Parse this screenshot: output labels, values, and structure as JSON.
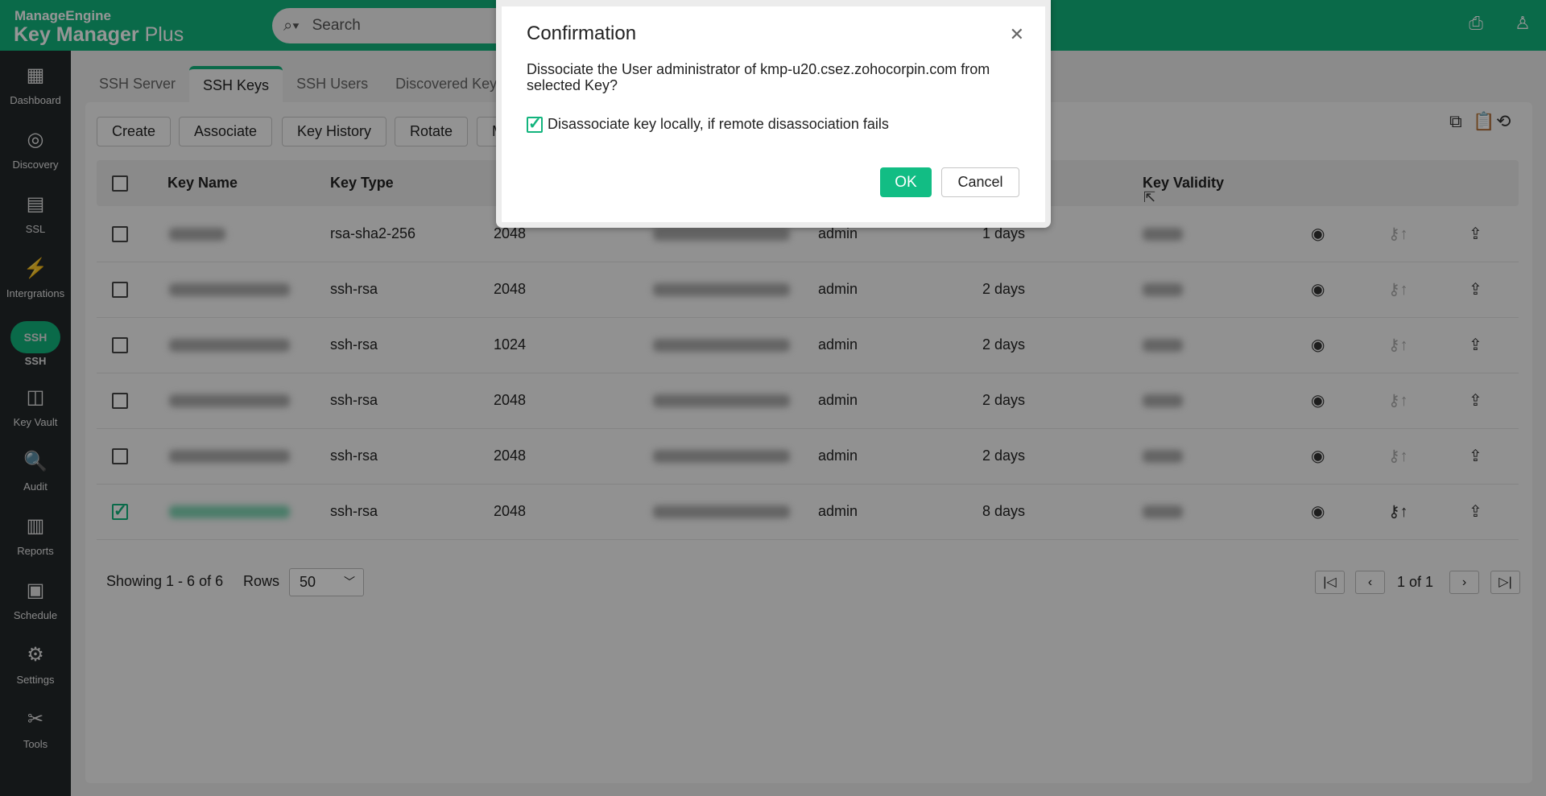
{
  "header": {
    "brand_top": "ManageEngine",
    "product_bold": "Key Manager",
    "product_light": " Plus",
    "search_placeholder": "Search",
    "icons": [
      "notification-icon",
      "user-icon"
    ]
  },
  "sidebar": {
    "items": [
      {
        "label": "Dashboard",
        "icon": "dashboard-icon",
        "glyph": "▦"
      },
      {
        "label": "Discovery",
        "icon": "compass-icon",
        "glyph": "◎"
      },
      {
        "label": "SSL",
        "icon": "ssl-certificate-icon",
        "glyph": "▤"
      },
      {
        "label": "Intergrations",
        "icon": "plug-icon",
        "glyph": "⚡"
      },
      {
        "label": "SSH",
        "icon": "ssh-terminal-icon",
        "glyph": "SSH",
        "active": true
      },
      {
        "label": "Key Vault",
        "icon": "vault-icon",
        "glyph": "◫"
      },
      {
        "label": "Audit",
        "icon": "audit-icon",
        "glyph": "🔍"
      },
      {
        "label": "Reports",
        "icon": "reports-icon",
        "glyph": "▥"
      },
      {
        "label": "Schedule",
        "icon": "calendar-icon",
        "glyph": "▣"
      },
      {
        "label": "Settings",
        "icon": "gear-icon",
        "glyph": "⚙"
      },
      {
        "label": "Tools",
        "icon": "tools-icon",
        "glyph": "✂"
      }
    ]
  },
  "tabs": [
    {
      "label": "SSH Server"
    },
    {
      "label": "SSH Keys",
      "active": true
    },
    {
      "label": "SSH Users"
    },
    {
      "label": "Discovered Keys"
    }
  ],
  "toolbar": {
    "buttons": [
      "Create",
      "Associate",
      "Key History",
      "Rotate",
      "M"
    ],
    "icons": [
      "copy-key-icon",
      "key-clipboard-icon",
      "key-reset-icon"
    ]
  },
  "table": {
    "headers": {
      "key_name": "Key Name",
      "key_type": "Key Type",
      "key_validity": "Key Validity"
    },
    "rows": [
      {
        "type": "rsa-sha2-256",
        "length": "2048",
        "user": "admin",
        "age": "1 days",
        "checked": false,
        "key_action_enabled": false
      },
      {
        "type": "ssh-rsa",
        "length": "2048",
        "user": "admin",
        "age": "2 days",
        "checked": false,
        "key_action_enabled": false
      },
      {
        "type": "ssh-rsa",
        "length": "1024",
        "user": "admin",
        "age": "2 days",
        "checked": false,
        "key_action_enabled": false
      },
      {
        "type": "ssh-rsa",
        "length": "2048",
        "user": "admin",
        "age": "2 days",
        "checked": false,
        "key_action_enabled": false
      },
      {
        "type": "ssh-rsa",
        "length": "2048",
        "user": "admin",
        "age": "2 days",
        "checked": false,
        "key_action_enabled": false
      },
      {
        "type": "ssh-rsa",
        "length": "2048",
        "user": "admin",
        "age": "8 days",
        "checked": true,
        "key_action_enabled": true
      }
    ]
  },
  "footer": {
    "showing": "Showing 1 - 6 of 6",
    "rows_label": "Rows",
    "rows_value": "50",
    "page": "1 of 1"
  },
  "dialog": {
    "title": "Confirmation",
    "message": "Dissociate the User administrator of kmp-u20.csez.zohocorpin.com from selected Key?",
    "checkbox_label": "Disassociate key locally, if remote disassociation fails",
    "checkbox_checked": true,
    "ok": "OK",
    "cancel": "Cancel"
  },
  "colors": {
    "accent": "#12b47d",
    "sidebar": "#22272a"
  }
}
